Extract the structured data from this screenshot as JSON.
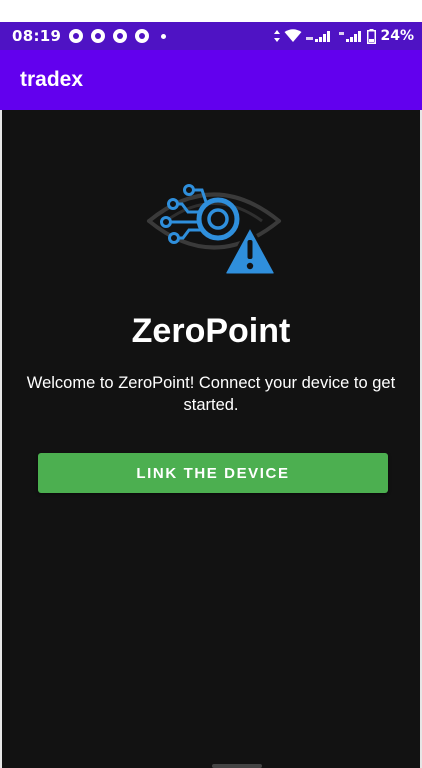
{
  "status_bar": {
    "time": "08:19",
    "battery_level": "24%",
    "background": "#4f13c4"
  },
  "app_bar": {
    "title": "tradex",
    "background": "#6200ee"
  },
  "main": {
    "logo_icon": "eye-circuit-warning-icon",
    "app_name": "ZeroPoint",
    "welcome_text": "Welcome to ZeroPoint! Connect your device to get started.",
    "link_button_label": "LINK THE DEVICE",
    "button_color": "#4caf50",
    "background": "#121212"
  }
}
